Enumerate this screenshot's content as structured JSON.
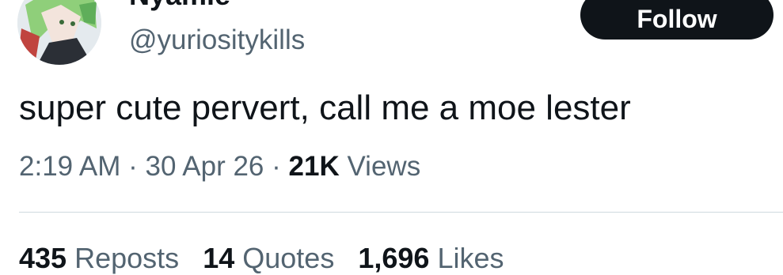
{
  "author": {
    "display_name": "Nyamie",
    "handle": "@yuriositykills",
    "avatar_icon": "anime-character-avatar"
  },
  "follow_button": {
    "label": "Follow",
    "bg_color": "#0f1419",
    "text_color": "#ffffff"
  },
  "tweet": {
    "text": "super cute pervert, call me a moe lester",
    "time": "2:19 AM",
    "separator": "·",
    "date": "30 Apr 26",
    "views_count": "21K",
    "views_label": "Views"
  },
  "stats": {
    "reposts_count": "435",
    "reposts_label": "Reposts",
    "quotes_count": "14",
    "quotes_label": "Quotes",
    "likes_count": "1,696",
    "likes_label": "Likes"
  },
  "colors": {
    "text_primary": "#0f1419",
    "text_secondary": "#536471",
    "divider": "#cfd9de"
  }
}
